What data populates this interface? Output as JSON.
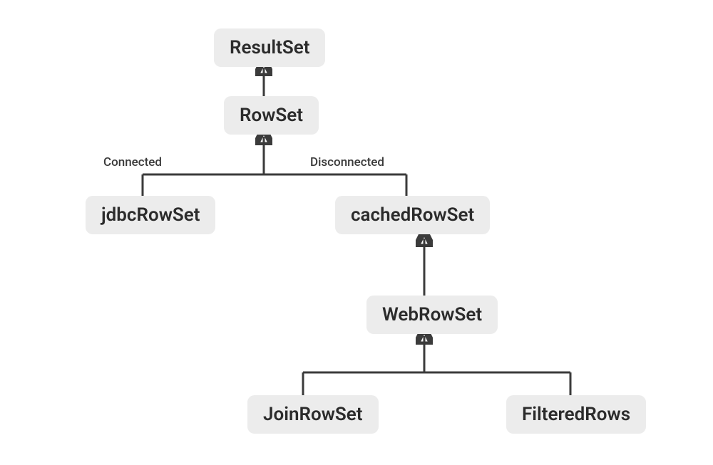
{
  "diagram": {
    "nodes": {
      "resultset": {
        "label": "ResultSet"
      },
      "rowset": {
        "label": "RowSet"
      },
      "jdbcrowset": {
        "label": "jdbcRowSet"
      },
      "cachedrowset": {
        "label": "cachedRowSet"
      },
      "webrowset": {
        "label": "WebRowSet"
      },
      "joinrowset": {
        "label": "JoinRowSet"
      },
      "filteredrows": {
        "label": "FilteredRows"
      }
    },
    "edge_labels": {
      "connected": "Connected",
      "disconnected": "Disconnected"
    },
    "colors": {
      "node_bg": "#ececec",
      "node_text": "#2b2b2b",
      "connector": "#3b3b3b",
      "canvas_bg": "#ffffff"
    },
    "hierarchy": {
      "root": "resultset",
      "children": {
        "resultset": [
          "rowset"
        ],
        "rowset": [
          "jdbcrowset",
          "cachedrowset"
        ],
        "cachedrowset": [
          "webrowset"
        ],
        "webrowset": [
          "joinrowset",
          "filteredrows"
        ]
      },
      "annotations": {
        "jdbcrowset": "connected",
        "cachedrowset": "disconnected"
      }
    }
  }
}
